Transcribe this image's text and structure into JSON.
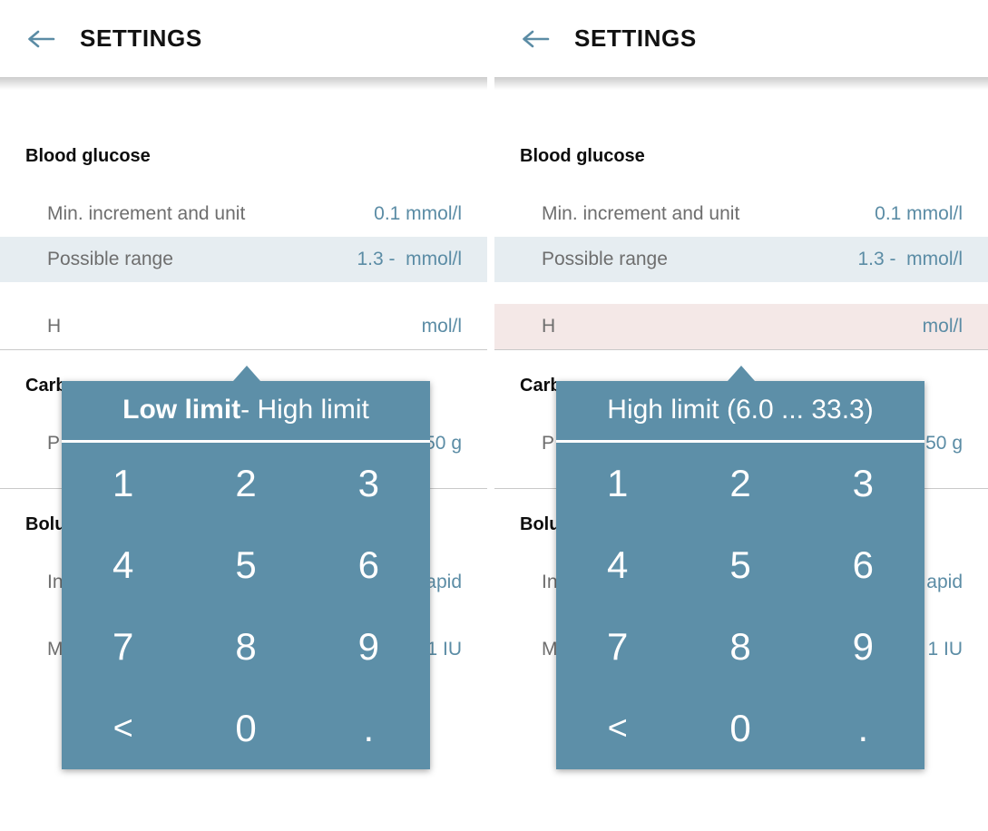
{
  "header": {
    "back_icon": "arrow-left-icon",
    "title": "SETTINGS"
  },
  "colors": {
    "accent": "#5b8ca5",
    "popup_bg": "#5d8fa8",
    "row_selected_blue": "#e6edf1",
    "row_selected_pink": "#f4e8e7",
    "label": "#6e6e6e",
    "divider": "#c9c9c9"
  },
  "list": {
    "sections": [
      {
        "title": "Blood glucose",
        "rows": [
          {
            "label": "Min. increment and unit",
            "value": "0.1 mmol/l",
            "state": "normal"
          },
          {
            "label": "Possible range",
            "value": "1.3 -  mmol/l",
            "state": "selected-blue"
          },
          {
            "label": "H",
            "value": "mol/l",
            "state": "normal",
            "state_right": "selected-pink"
          }
        ]
      },
      {
        "title": "Carb",
        "rows": [
          {
            "label": "P",
            "value": "50 g",
            "state": "normal"
          }
        ]
      },
      {
        "title": "Bolu",
        "rows": [
          {
            "label": "In",
            "value": "apid",
            "state": "normal"
          },
          {
            "label": "Min. increment and unit",
            "value": "1 IU",
            "state": "normal"
          }
        ]
      }
    ]
  },
  "popup_left": {
    "title_bold": "Low limit",
    "title_rest": " - High limit",
    "keys": [
      "1",
      "2",
      "3",
      "4",
      "5",
      "6",
      "7",
      "8",
      "9",
      "<",
      "0",
      "."
    ]
  },
  "popup_right": {
    "title_bold": "",
    "title_rest": "High limit (6.0 ... 33.3)",
    "keys": [
      "1",
      "2",
      "3",
      "4",
      "5",
      "6",
      "7",
      "8",
      "9",
      "<",
      "0",
      "."
    ]
  }
}
